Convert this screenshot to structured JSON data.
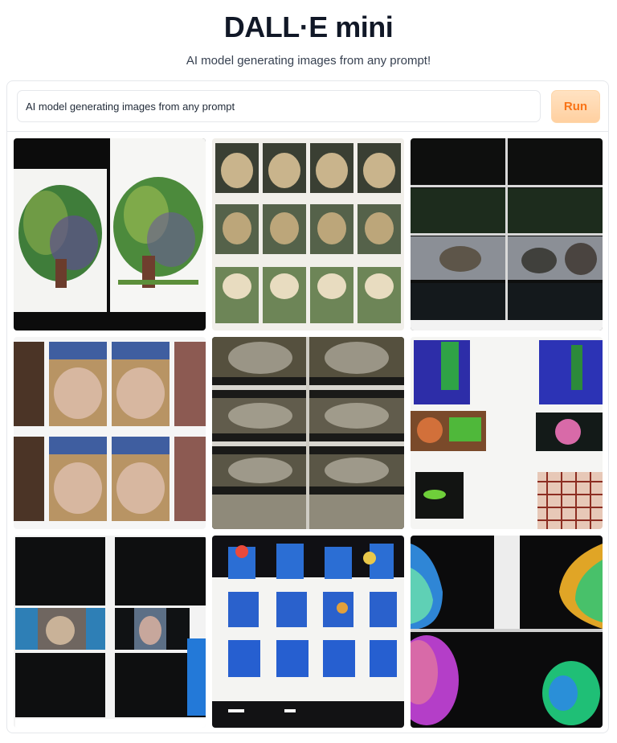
{
  "header": {
    "title": "DALL·E mini",
    "subtitle": "AI model generating images from any prompt!"
  },
  "prompt": {
    "value": "AI model generating images from any prompt"
  },
  "run_button": {
    "label": "Run"
  },
  "colors": {
    "accent": "#f97316",
    "run_bg": "#ffd8b0",
    "border": "#e5e7eb"
  },
  "gallery": {
    "images": [
      {
        "name": "generated-image-1",
        "theme": "twin-trees-on-white"
      },
      {
        "name": "generated-image-2",
        "theme": "animal-photo-grid"
      },
      {
        "name": "generated-image-3",
        "theme": "dark-panels-landscape"
      },
      {
        "name": "generated-image-4",
        "theme": "face-photo-grid"
      },
      {
        "name": "generated-image-5",
        "theme": "sepia-strip-grid"
      },
      {
        "name": "generated-image-6",
        "theme": "colorful-collage-on-white"
      },
      {
        "name": "generated-image-7",
        "theme": "black-panels-faces"
      },
      {
        "name": "generated-image-8",
        "theme": "blue-squares-grid"
      },
      {
        "name": "generated-image-9",
        "theme": "neon-heads-dark"
      }
    ]
  }
}
